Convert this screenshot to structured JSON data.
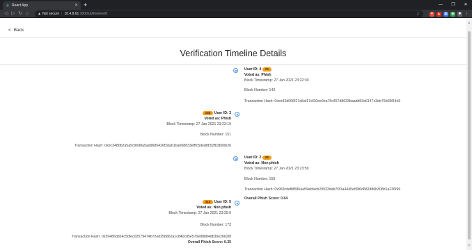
{
  "browser": {
    "tab_title": "React App",
    "new_tab_label": "+",
    "url_warning": "Not secure",
    "url_host": "10.4.8.61",
    "url_path": ":3000/ut/timeline/0",
    "icons": [
      "react-icon",
      "back-arrow-icon",
      "forward-arrow-icon",
      "reload-icon",
      "home-icon",
      "warning-icon",
      "key-icon"
    ]
  },
  "page": {
    "back_label": "Back",
    "title": "Verification Timeline Details",
    "entries": [
      {
        "side": "right",
        "user": "User ID: 4",
        "badge": "75",
        "voted": "Voted as: Phish",
        "timestamp": "Block Timestamp: 27 Jan 2021 23:22:39",
        "block": "Block Number: 143",
        "hash": "Transaction Hash: 0xee42d066f27a5af17ef20ee0ea75c457d8633baadd53a6147c3de76b05f34e5"
      },
      {
        "side": "left",
        "user": "User ID: 3",
        "badge": "150",
        "voted": "Voted as: Phish",
        "timestamp": "Block Timestamp: 27 Jan 2021 23:23:19",
        "block": "Block Number: 151",
        "hash": "Transaction Hash: 0xbc3480b2a5a5c9b98a5add685426f2da61ba608833efffc5ded8b52fb3b90b26"
      },
      {
        "side": "right",
        "user": "User ID: 2",
        "badge": "38",
        "voted": "Voted as: Non phish",
        "timestamp": "Block Timestamp: 27 Jan 2021 23:23:59",
        "block": "Block Number: 159",
        "hash": "Transaction Hash: 0x969cdefbf586aa59abfacb29933dab7f31a4445e89f6d682d86b308b1a236f96",
        "score": "Overall Phish Score: 0.64"
      },
      {
        "side": "left",
        "user": "User ID: 5",
        "badge": "115",
        "voted": "Voted as: Non phish",
        "timestamp": "Block Timestamp: 27 Jan 2021 23:25:9",
        "block": "Block Number: 173",
        "hash": "Transaction Hash: 0x39486dd24c50fec02579474b72ed358d62a1c840cd5e570e88b84db30e26626f",
        "score": "Overall Phish Score: 0.35"
      }
    ]
  }
}
